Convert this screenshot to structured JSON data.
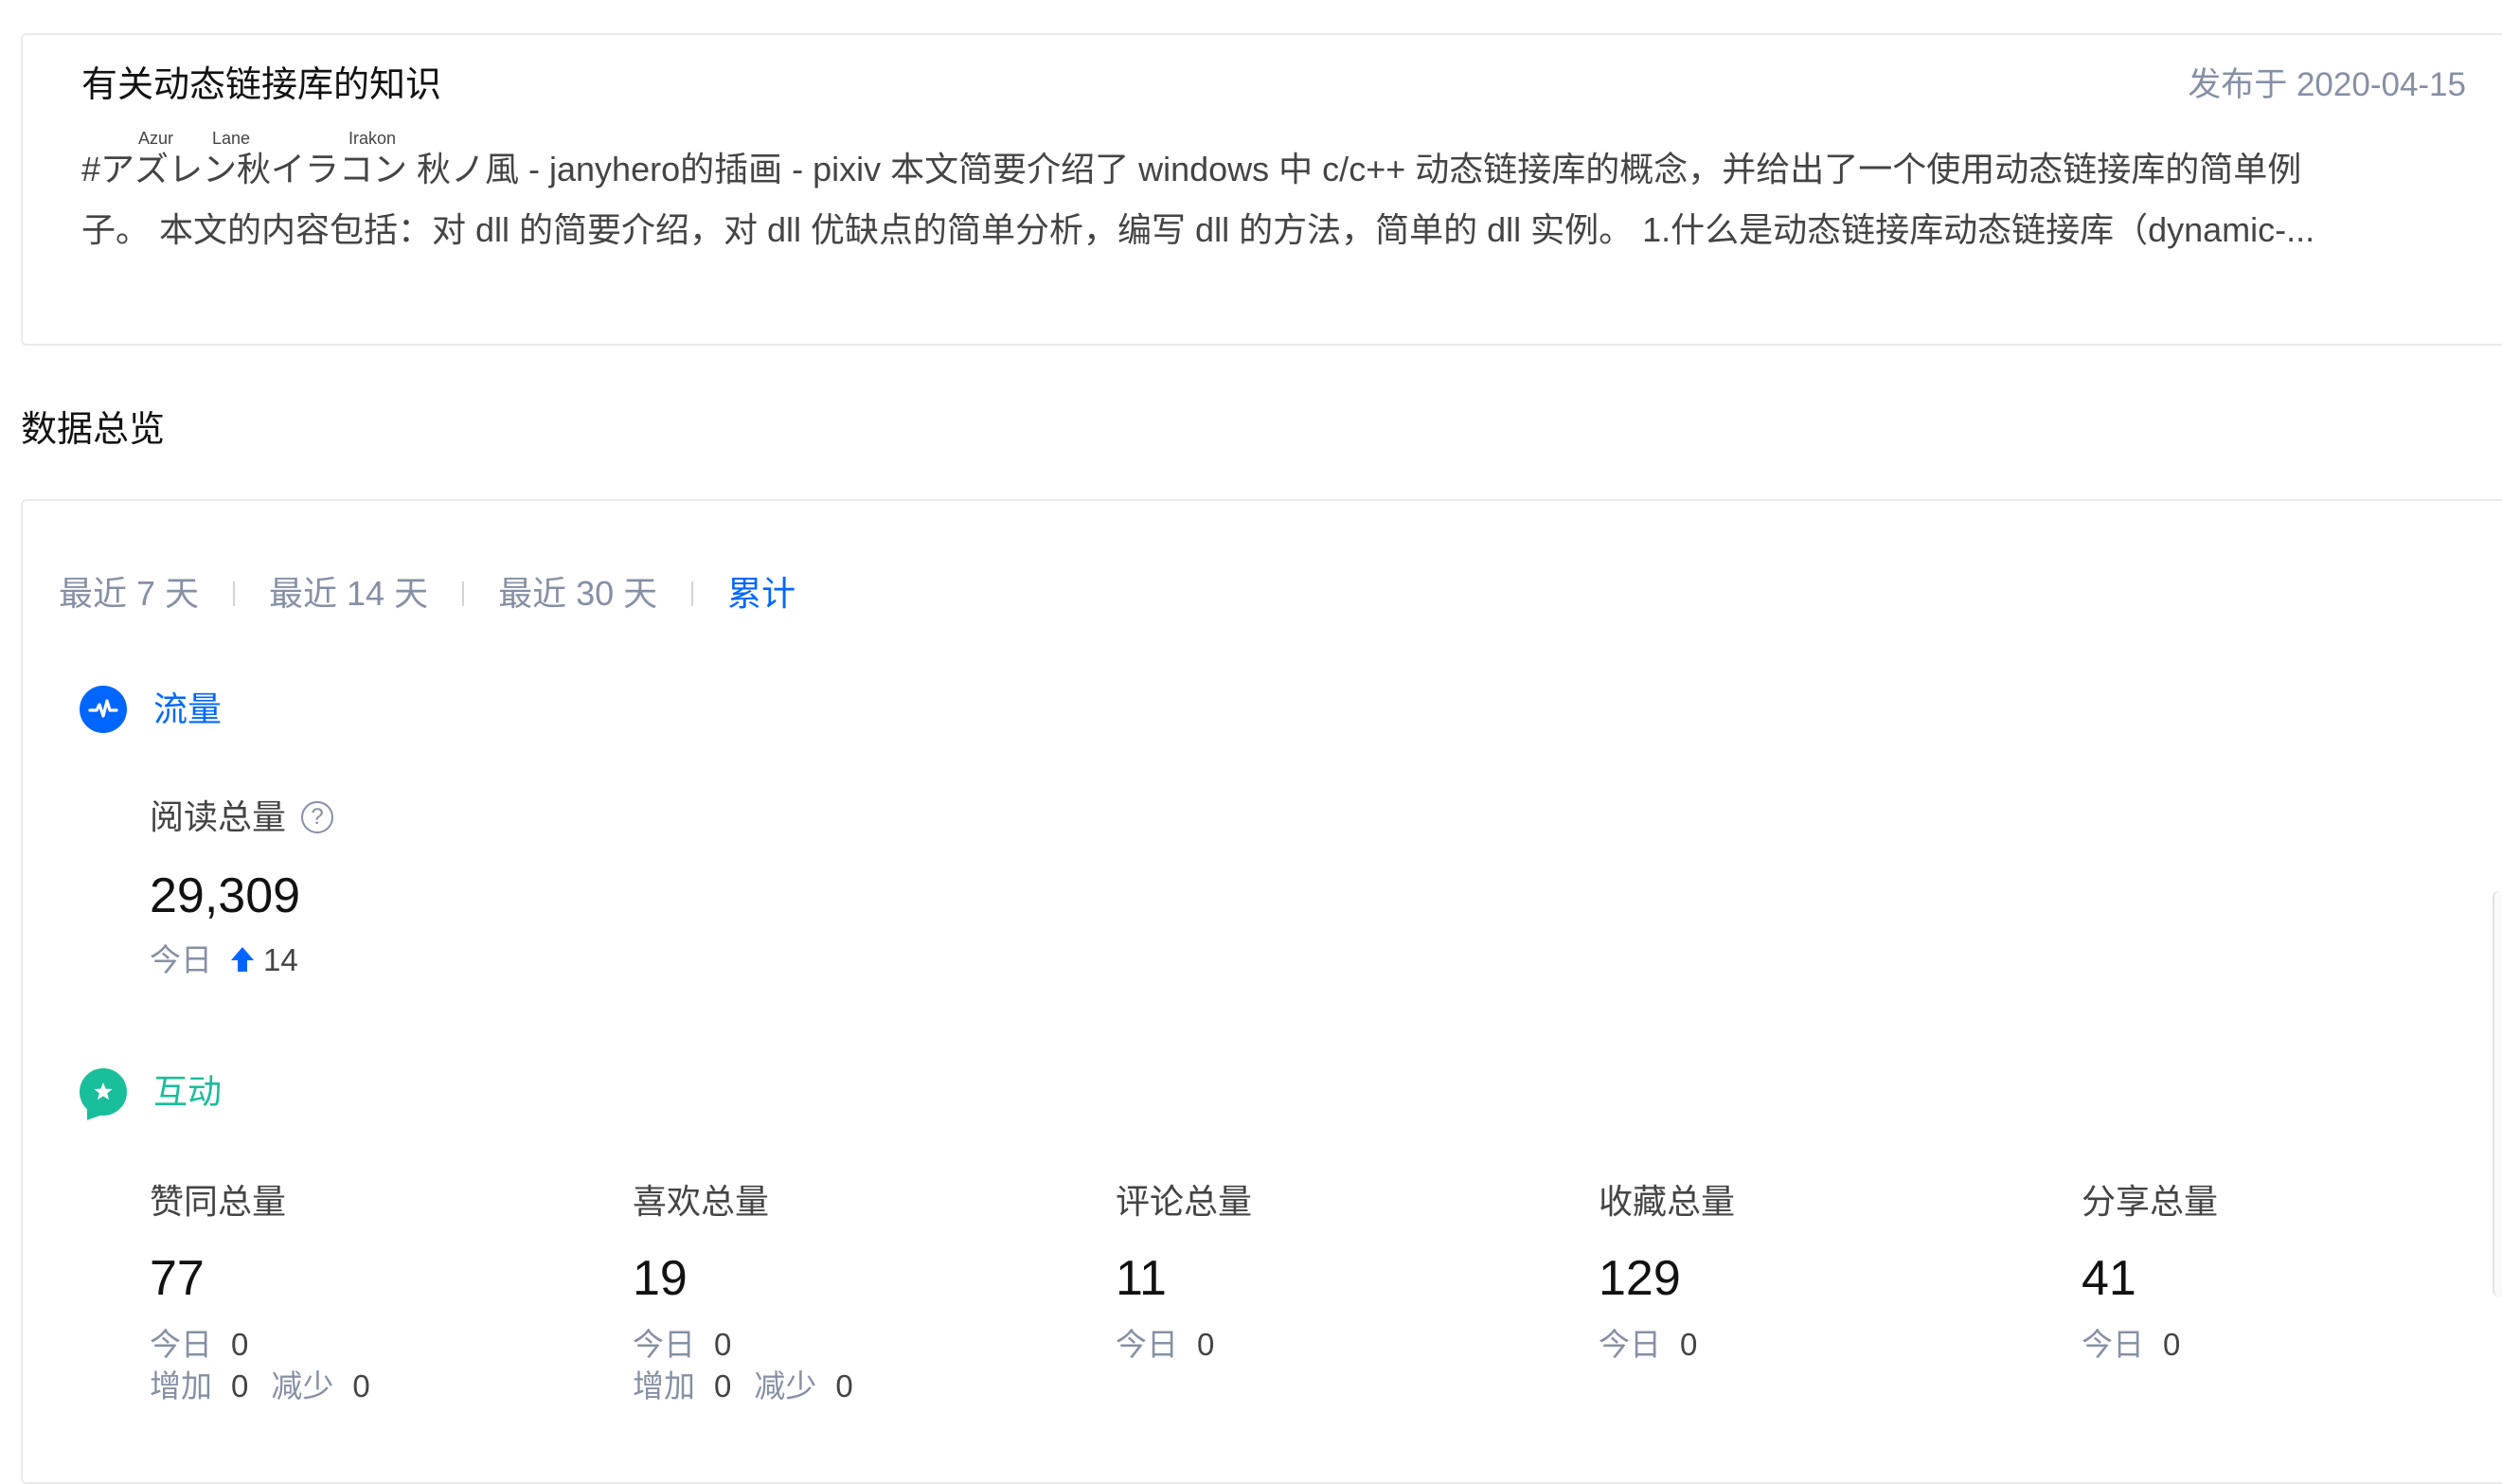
{
  "article": {
    "title": "有关动态链接库的知识",
    "date": "发布于 2020-04-15",
    "ruby": [
      "Azur",
      "Lane",
      "Irakon"
    ],
    "excerpt_line1": "#アズレン秋イラコン 秋ノ風 - janyhero的插画 - pixiv 本文简要介绍了 windows 中 c/c++ 动态链接库的概念，并给出了一个使用动态链接库的简单例",
    "excerpt_line2": "子。 本文的内容包括：对 dll 的简要介绍，对 dll 优缺点的简单分析，编写 dll 的方法，简单的 dll 实例。 1.什么是动态链接库动态链接库（dynamic-..."
  },
  "overview": {
    "title": "数据总览"
  },
  "range_tabs": {
    "items": [
      "最近 7 天",
      "最近 14 天",
      "最近 30 天",
      "累计"
    ],
    "active_index": 3
  },
  "colors": {
    "accent_blue": "#0066ff",
    "accent_green": "#19be9b",
    "muted": "#8590a6"
  },
  "traffic": {
    "label": "流量",
    "icon": "pulse-icon",
    "reads": {
      "label": "阅读总量",
      "help": "?",
      "value": "29,309",
      "today_label": "今日",
      "today_value": "14"
    }
  },
  "interaction": {
    "label": "互动",
    "icon": "star-chat-icon",
    "metrics": [
      {
        "label": "赞同总量",
        "value": "77",
        "today_label": "今日",
        "today_value": "0",
        "inc_label": "增加",
        "inc_value": "0",
        "dec_label": "减少",
        "dec_value": "0"
      },
      {
        "label": "喜欢总量",
        "value": "19",
        "today_label": "今日",
        "today_value": "0",
        "inc_label": "增加",
        "inc_value": "0",
        "dec_label": "减少",
        "dec_value": "0"
      },
      {
        "label": "评论总量",
        "value": "11",
        "today_label": "今日",
        "today_value": "0"
      },
      {
        "label": "收藏总量",
        "value": "129",
        "today_label": "今日",
        "today_value": "0"
      },
      {
        "label": "分享总量",
        "value": "41",
        "today_label": "今日",
        "today_value": "0"
      }
    ]
  }
}
